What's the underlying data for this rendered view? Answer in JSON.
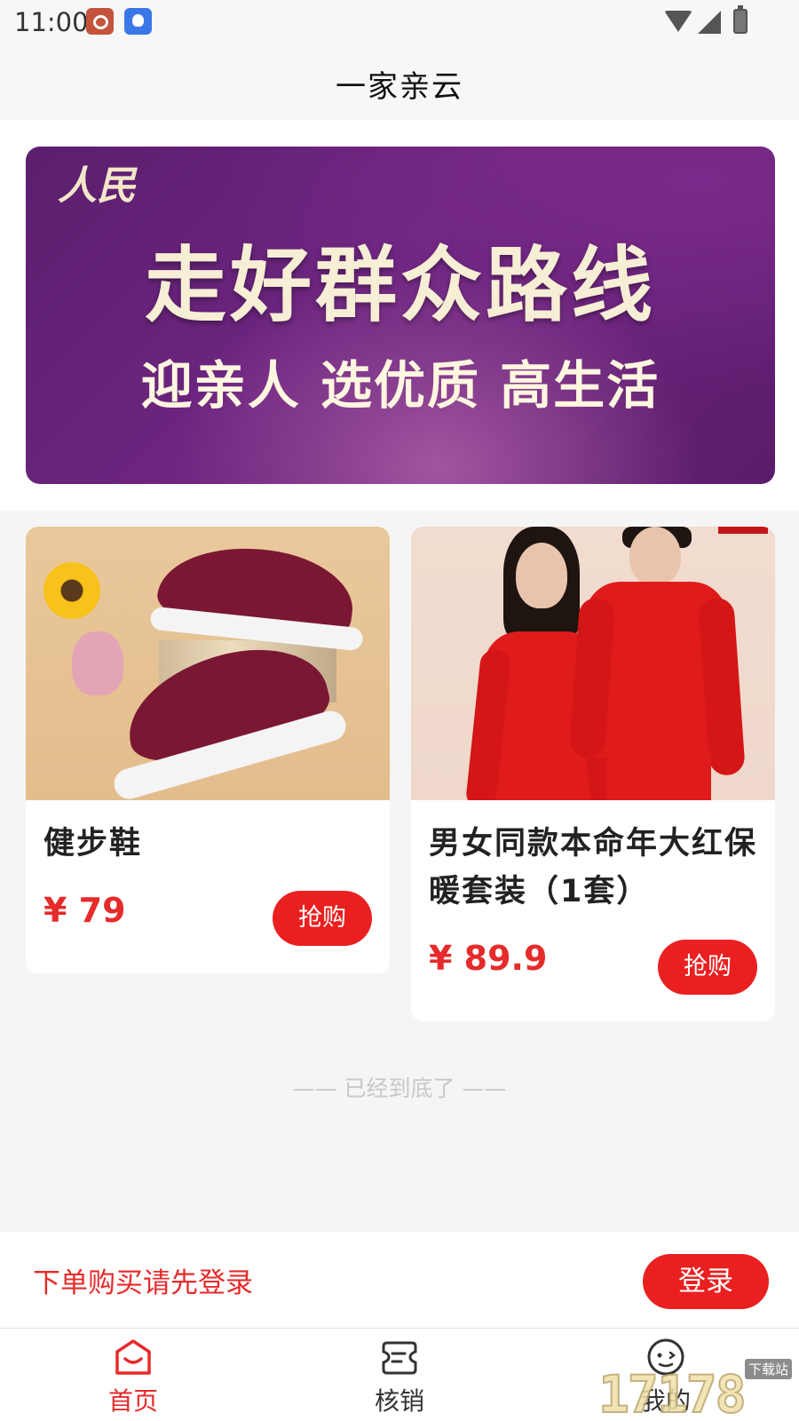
{
  "status_bar": {
    "time": "11:00"
  },
  "header": {
    "title": "一家亲云"
  },
  "banner": {
    "logo": "人民",
    "headline": "走好群众路线",
    "subline": "迎亲人 选优质 高生活"
  },
  "products": [
    {
      "title": "健步鞋",
      "price": "¥ 79",
      "buy_label": "抢购"
    },
    {
      "title": "男女同款本命年大红保暖套装（1套）",
      "price": "¥ 89.9",
      "buy_label": "抢购"
    }
  ],
  "list_end_text": "—— 已经到底了 ——",
  "login_bar": {
    "prompt": "下单购买请先登录",
    "button": "登录"
  },
  "tabs": [
    {
      "label": "首页",
      "icon": "home-bag-icon",
      "active": true
    },
    {
      "label": "核销",
      "icon": "ticket-icon",
      "active": false
    },
    {
      "label": "我的",
      "icon": "face-icon",
      "active": false
    }
  ],
  "watermark": {
    "text": "17178",
    "badge": "下载站"
  },
  "colors": {
    "accent": "#ea2020",
    "price": "#e62b2b",
    "banner": "#6e2580"
  }
}
